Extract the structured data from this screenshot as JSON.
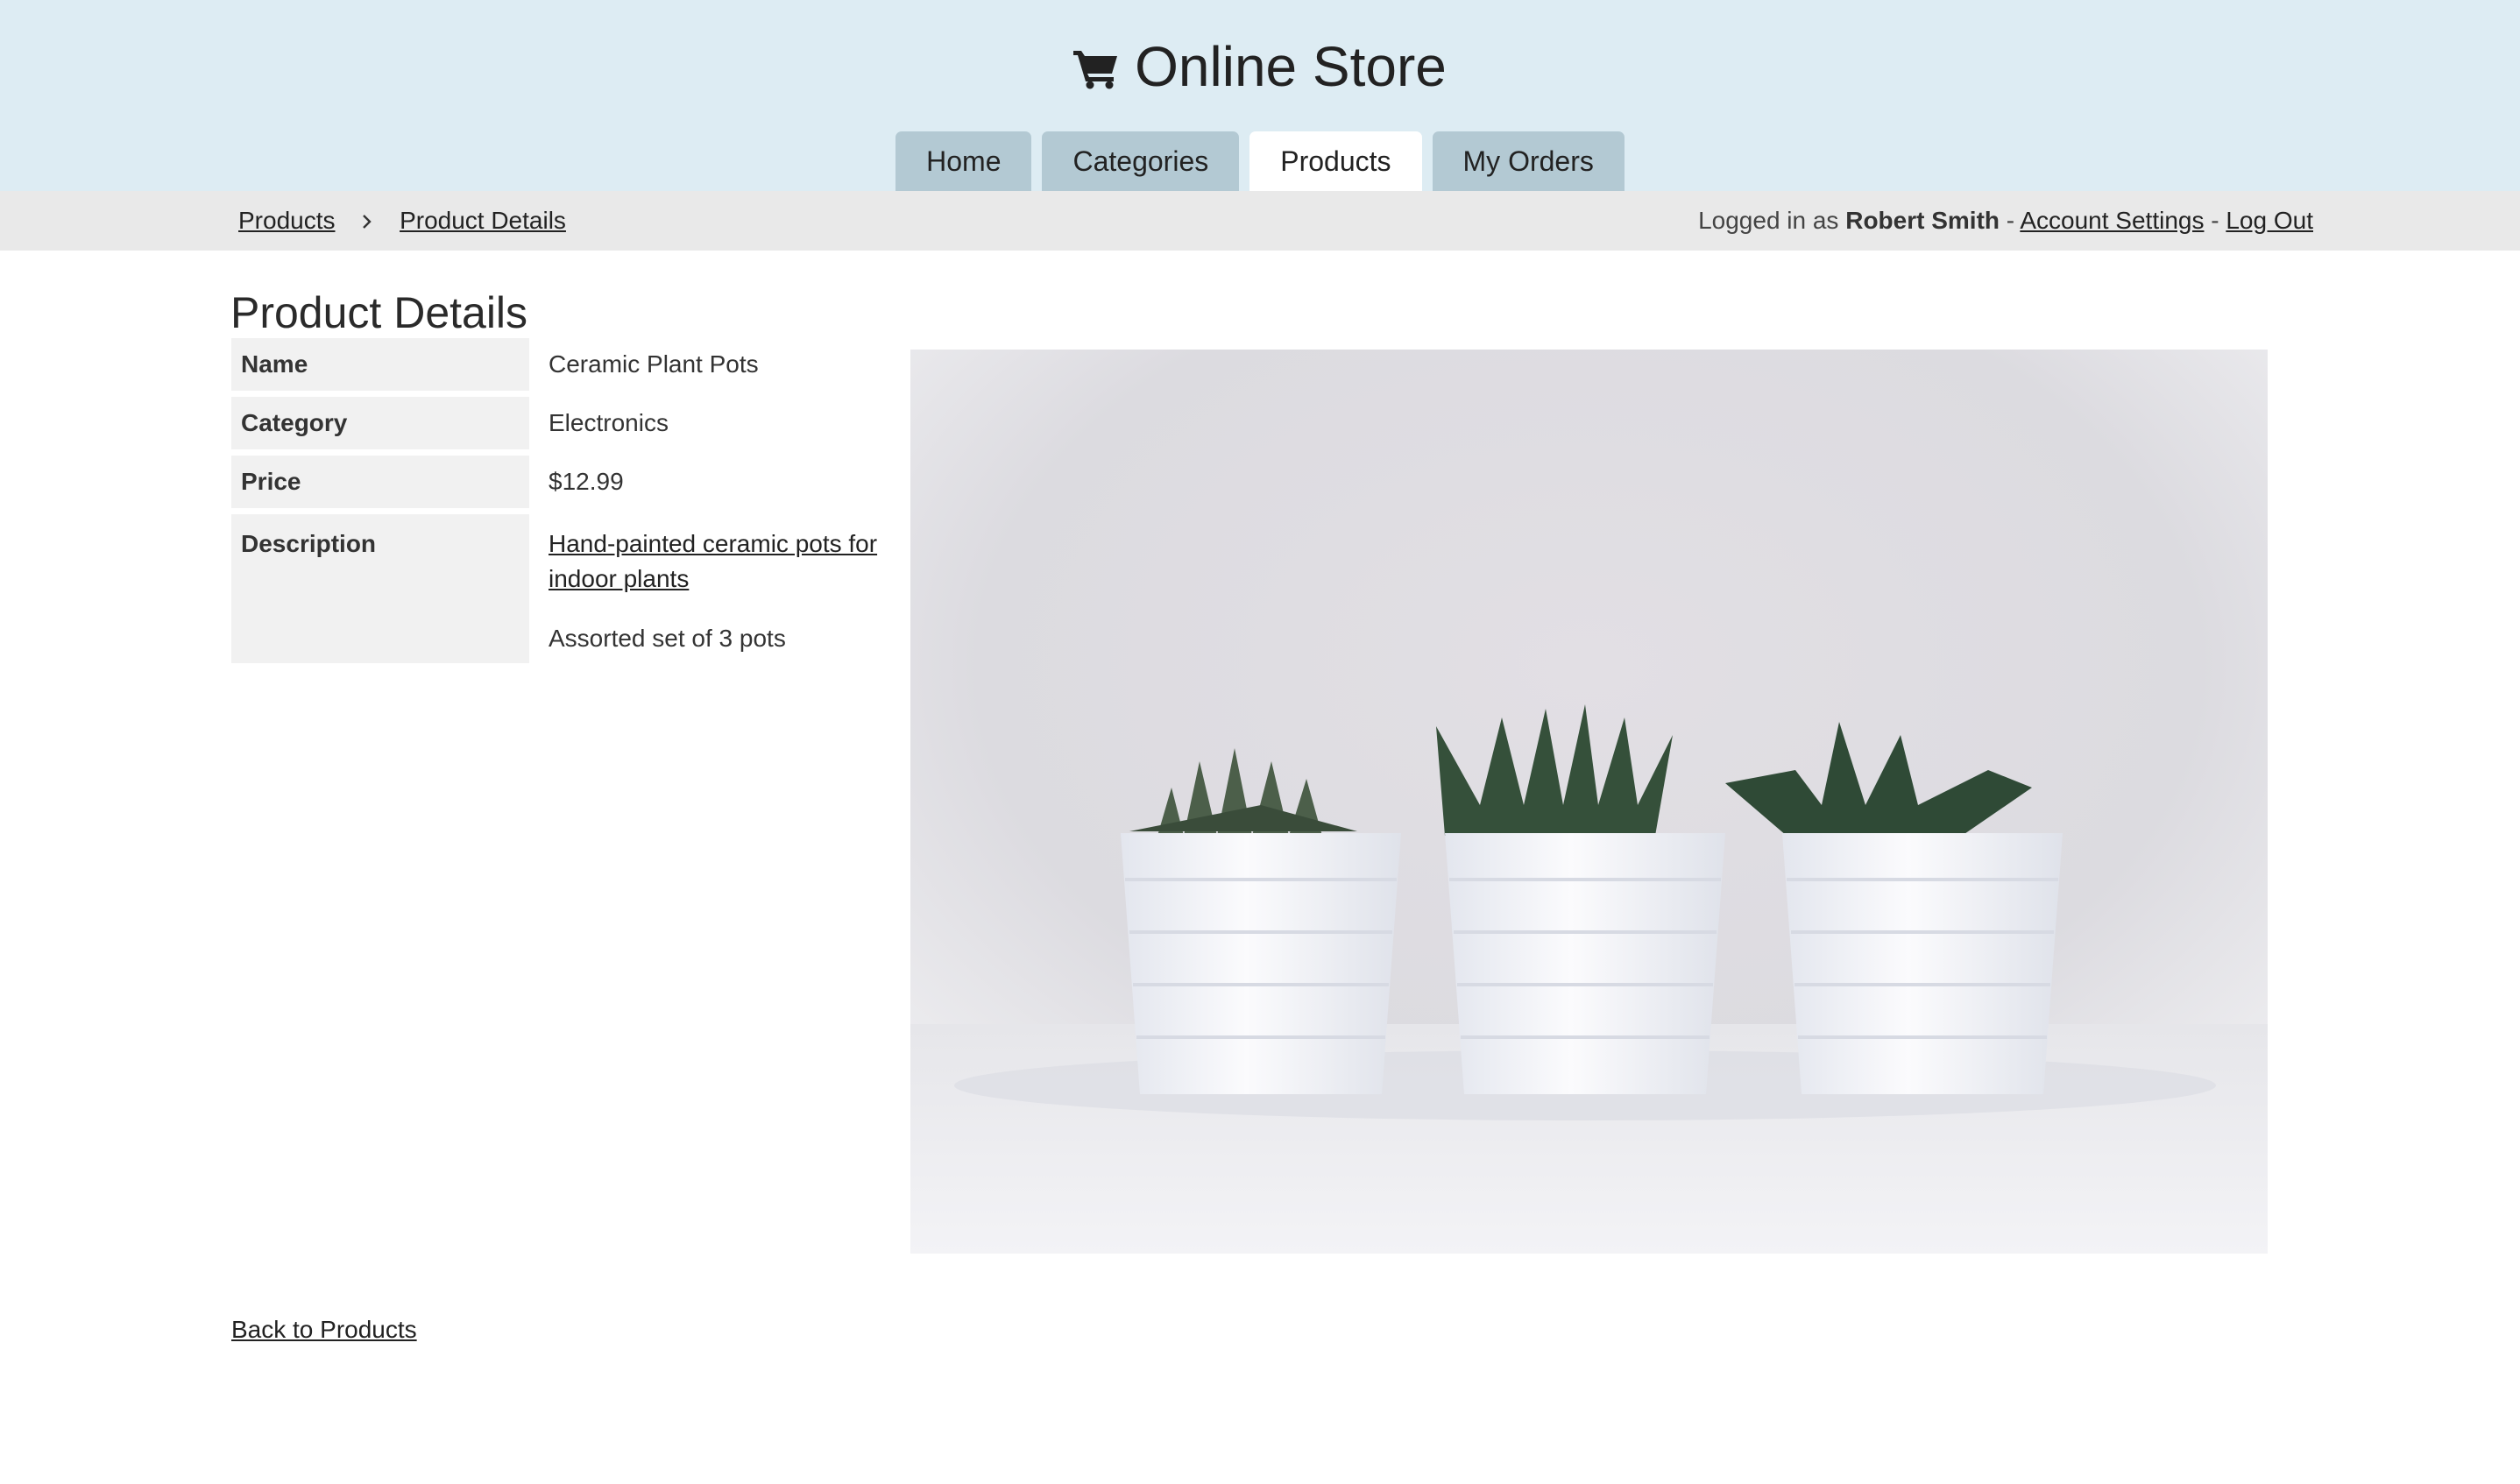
{
  "header": {
    "title": "Online Store",
    "icon": "shopping-cart-icon",
    "tabs": [
      {
        "label": "Home",
        "active": false
      },
      {
        "label": "Categories",
        "active": false
      },
      {
        "label": "Products",
        "active": true
      },
      {
        "label": "My Orders",
        "active": false
      }
    ]
  },
  "breadcrumb": {
    "items": [
      "Products",
      "Product Details"
    ]
  },
  "user": {
    "prefix": "Logged in as",
    "name": "Robert Smith",
    "separator": "-",
    "account_settings": "Account Settings",
    "log_out": "Log Out"
  },
  "page": {
    "title": "Product Details"
  },
  "product": {
    "labels": {
      "name": "Name",
      "category": "Category",
      "price": "Price",
      "description": "Description"
    },
    "name": "Ceramic Plant Pots",
    "category": "Electronics",
    "price": "$12.99",
    "description_link": "Hand-painted ceramic pots for indoor plants",
    "description_extra": "Assorted set of 3 pots"
  },
  "footer": {
    "back_link": "Back to Products"
  },
  "colors": {
    "header_bg": "#ddecf3",
    "tab_bg": "#b3c9d3",
    "active_tab_bg": "#ffffff",
    "subbar_bg": "#e9e9e9",
    "label_bg": "#f1f1f1"
  }
}
